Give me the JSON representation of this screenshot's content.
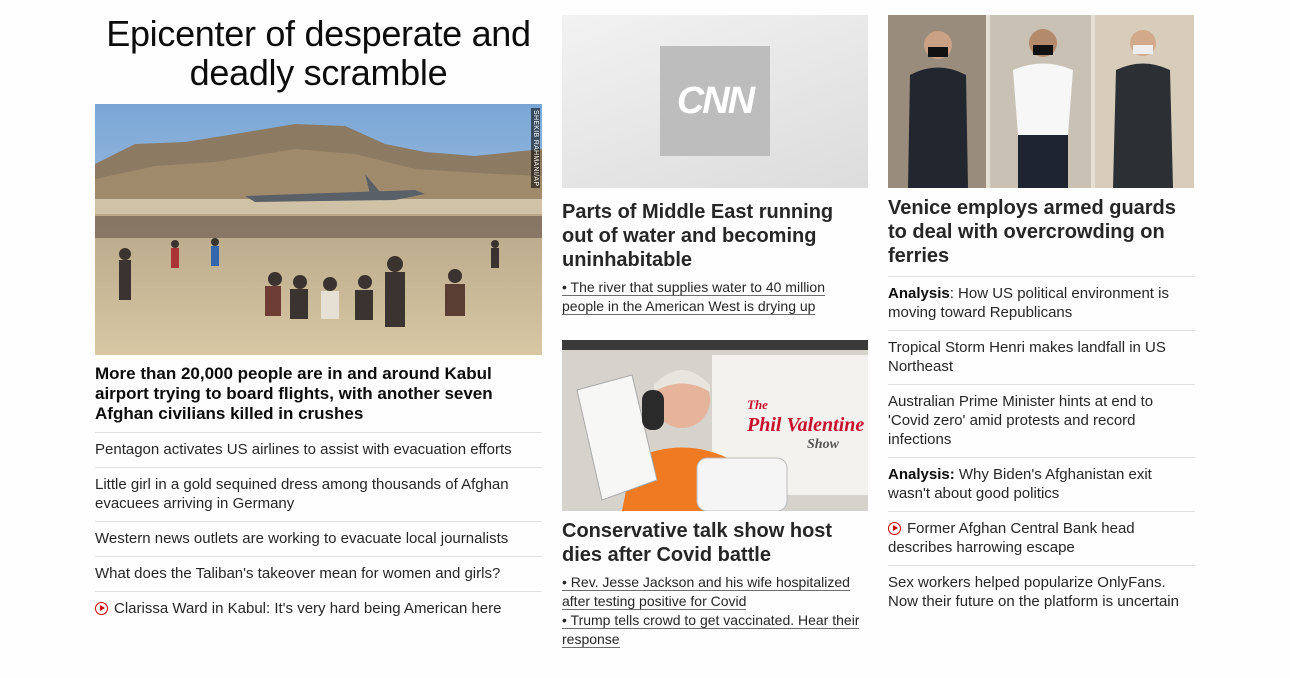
{
  "col1": {
    "section_title": "Epicenter of desperate and deadly scramble",
    "hero_credit": "SHEKIB RAHMANI/AP",
    "lead_headline": "More than 20,000 people are in and around Kabul airport trying to board flights, with another seven Afghan civilians killed in crushes",
    "items": [
      {
        "text": "Pentagon activates US airlines to assist with evacuation efforts"
      },
      {
        "text": "Little girl in a gold sequined dress among thousands of Afghan evacuees arriving in Germany"
      },
      {
        "text": "Western news outlets are working to evacuate local journalists"
      },
      {
        "text": "What does the Taliban's takeover mean for women and girls?"
      },
      {
        "text": "Clarissa Ward in Kabul: It's very hard being American here",
        "icon": "play-video-icon"
      }
    ]
  },
  "col2": {
    "card1": {
      "logo_text": "CNN",
      "headline": "Parts of Middle East running out of water and becoming uninhabitable",
      "sub": [
        "• The river that supplies water to 40 million people in the American West is drying up"
      ]
    },
    "card2": {
      "banner_top": "The",
      "banner_name": "Phil Valentine",
      "banner_show": "Show",
      "headline": "Conservative talk show host dies after Covid battle",
      "sub": [
        "• Rev. Jesse Jackson and his wife hospitalized after testing positive for Covid",
        "• Trump tells crowd to get vaccinated. Hear their response"
      ]
    }
  },
  "col3": {
    "headline": "Venice employs armed guards to deal with overcrowding on ferries",
    "items": [
      {
        "prefix": "Analysis",
        "text": ": How US political environment is moving toward Republicans"
      },
      {
        "text": "Tropical Storm Henri makes landfall in US Northeast"
      },
      {
        "text": "Australian Prime Minister hints at end to 'Covid zero' amid protests and record infections"
      },
      {
        "prefix": "Analysis:",
        "text": " Why Biden's Afghanistan exit wasn't about good politics"
      },
      {
        "text": "Former Afghan Central Bank head describes harrowing escape",
        "icon": "play-video-icon"
      },
      {
        "text": "Sex workers helped popularize OnlyFans. Now their future on the platform is uncertain"
      }
    ]
  },
  "colors": {
    "accent_red": "#cc0000",
    "text": "#262626",
    "divider": "#e1e1e1"
  }
}
